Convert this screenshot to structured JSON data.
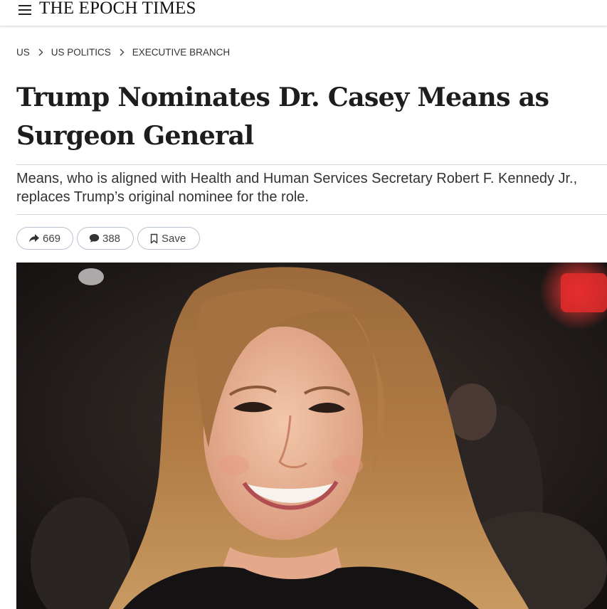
{
  "header": {
    "logo_text": "THE EPOCH TIMES",
    "menu_icon": "hamburger-menu-icon"
  },
  "breadcrumb": [
    {
      "label": "US"
    },
    {
      "label": "US POLITICS"
    },
    {
      "label": "EXECUTIVE BRANCH"
    }
  ],
  "breadcrumb_separator_icon": "chevron-right-icon",
  "article": {
    "headline": "Trump Nominates Dr. Casey Means as Surgeon General",
    "subheadline": "Means, who is aligned with Health and Human Services Secretary Robert F. Kennedy Jr., replaces Trump’s original nominee for the role."
  },
  "actions": {
    "share_count": "669",
    "share_icon": "share-arrow-icon",
    "comment_count": "388",
    "comment_icon": "comment-bubble-icon",
    "save_label": "Save",
    "save_icon": "bookmark-icon"
  },
  "colors": {
    "text": "#222222",
    "pill_border": "#b9c3cf",
    "rule": "#d6d6d6"
  }
}
